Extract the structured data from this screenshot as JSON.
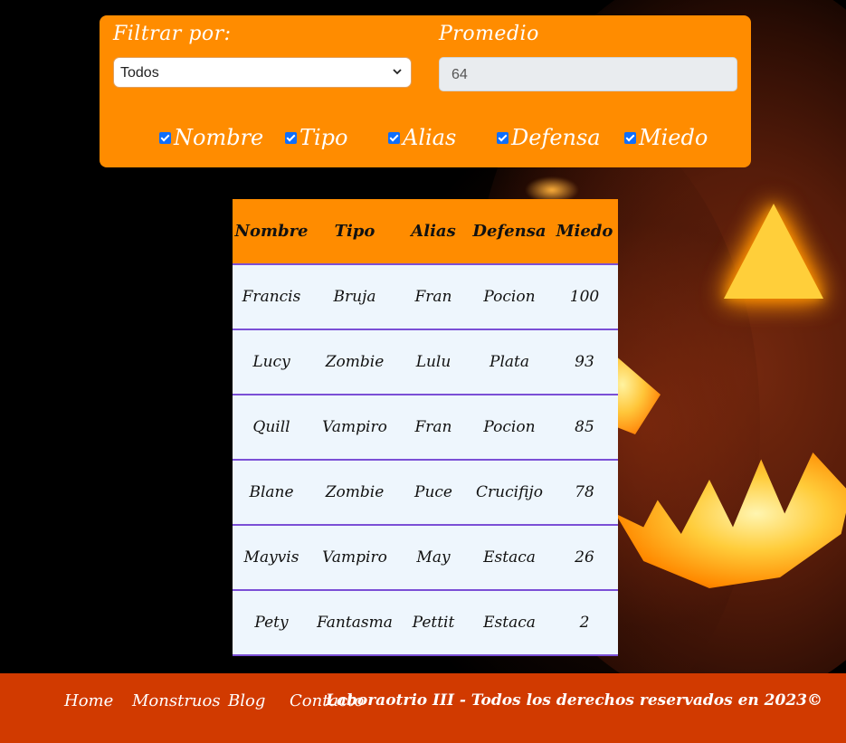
{
  "filter": {
    "filter_label": "Filtrar por:",
    "filter_selected": "Todos",
    "average_label": "Promedio",
    "average_value": "64",
    "columns": [
      {
        "label": "Nombre",
        "checked": true
      },
      {
        "label": "Tipo",
        "checked": true
      },
      {
        "label": "Alias",
        "checked": true
      },
      {
        "label": "Defensa",
        "checked": true
      },
      {
        "label": "Miedo",
        "checked": true
      }
    ]
  },
  "table": {
    "headers": [
      "Nombre",
      "Tipo",
      "Alias",
      "Defensa",
      "Miedo"
    ],
    "rows": [
      [
        "Francis",
        "Bruja",
        "Fran",
        "Pocion",
        "100"
      ],
      [
        "Lucy",
        "Zombie",
        "Lulu",
        "Plata",
        "93"
      ],
      [
        "Quill",
        "Vampiro",
        "Fran",
        "Pocion",
        "85"
      ],
      [
        "Blane",
        "Zombie",
        "Puce",
        "Crucifijo",
        "78"
      ],
      [
        "Mayvis",
        "Vampiro",
        "May",
        "Estaca",
        "26"
      ],
      [
        "Pety",
        "Fantasma",
        "Pettit",
        "Estaca",
        "2"
      ]
    ]
  },
  "footer": {
    "links": [
      "Home",
      "Monstruos",
      "Blog",
      "Contacto"
    ],
    "copyright": "Laboraotrio III - Todos los derechos reservados en 2023©"
  },
  "colors": {
    "panel": "#ff8c00",
    "footer": "#d13a00",
    "row_border": "#7b4fd6",
    "row_bg": "#eef6fd"
  }
}
